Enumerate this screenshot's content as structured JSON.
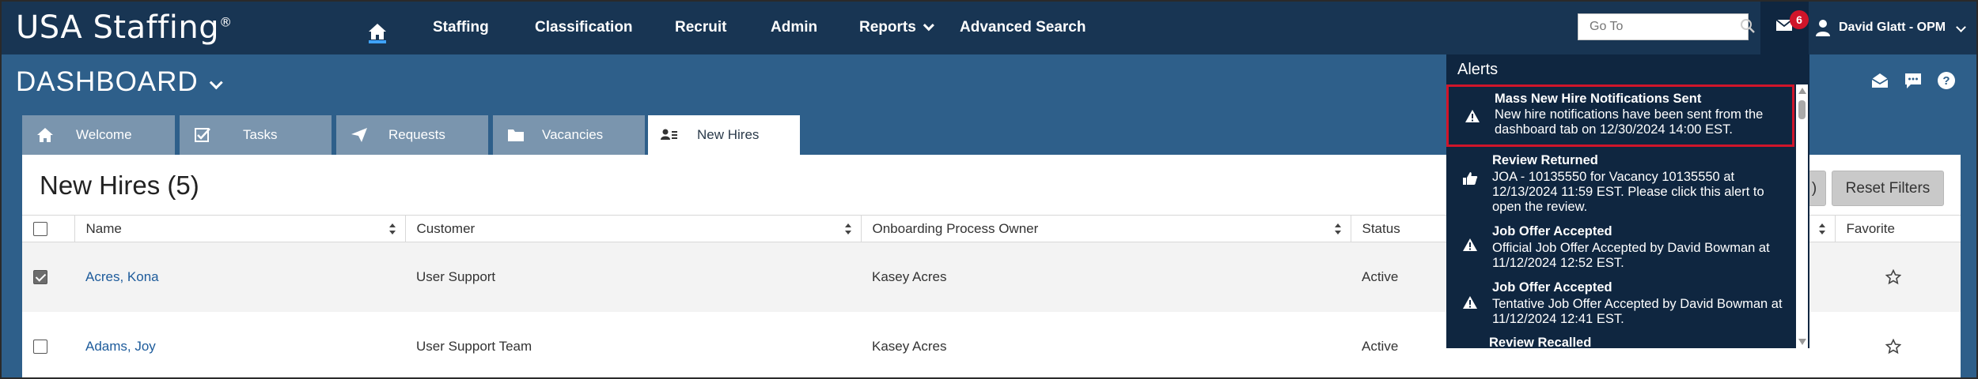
{
  "brand": {
    "name": "USA Staffing",
    "mark": "®"
  },
  "topnav": {
    "items": [
      {
        "label": "Staffing"
      },
      {
        "label": "Classification"
      },
      {
        "label": "Recruit"
      },
      {
        "label": "Admin"
      },
      {
        "label": "Reports"
      },
      {
        "label": "Advanced Search"
      }
    ],
    "goto_placeholder": "Go To",
    "notification_count": "6",
    "user_name": "David Glatt - OPM"
  },
  "header": {
    "title": "DASHBOARD"
  },
  "tabs": [
    {
      "label": "Welcome",
      "icon": "home-icon"
    },
    {
      "label": "Tasks",
      "icon": "checkbox-icon"
    },
    {
      "label": "Requests",
      "icon": "paper-plane-icon"
    },
    {
      "label": "Vacancies",
      "icon": "folder-icon"
    },
    {
      "label": "New Hires",
      "icon": "person-list-icon",
      "active": true
    }
  ],
  "main": {
    "section_title": "New Hires (5)",
    "reset_filters_label": "Reset Filters",
    "partial_button_label": ")",
    "columns": [
      "Name",
      "Customer",
      "Onboarding Process Owner",
      "Status",
      "Favorite"
    ],
    "rows": [
      {
        "checked": true,
        "name": "Acres, Kona",
        "customer": "User Support",
        "owner": "Kasey Acres",
        "status": "Active"
      },
      {
        "checked": false,
        "name": "Adams, Joy",
        "customer": "User Support Team",
        "owner": "Kasey Acres",
        "status": "Active"
      }
    ]
  },
  "alerts": {
    "title": "Alerts",
    "items": [
      {
        "icon": "warning-icon",
        "title": "Mass New Hire Notifications Sent",
        "body": "New hire notifications have been sent from the dashboard tab on 12/30/2024 14:00 EST.",
        "highlighted": true
      },
      {
        "icon": "thumbs-up-icon",
        "title": "Review Returned",
        "body": "JOA - 10135550 for Vacancy 10135550 at 12/13/2024 11:59 EST. Please click this alert to open the review."
      },
      {
        "icon": "warning-icon",
        "title": "Job Offer Accepted",
        "body": "Official Job Offer Accepted by David Bowman at 11/12/2024 12:52 EST."
      },
      {
        "icon": "warning-icon",
        "title": "Job Offer Accepted",
        "body": "Tentative Job Offer Accepted by David Bowman at 11/12/2024 12:41 EST."
      },
      {
        "icon": "warning-icon",
        "title": "Review Recalled",
        "body": ""
      }
    ]
  },
  "colors": {
    "nav_bg": "#183553",
    "page_bg": "#2e5f8a",
    "alerts_bg": "#0f2640",
    "highlight_red": "#d0152a",
    "badge_red": "#d0152a",
    "link_blue": "#1d5b9b",
    "tab_inactive": "#7a95ae"
  }
}
